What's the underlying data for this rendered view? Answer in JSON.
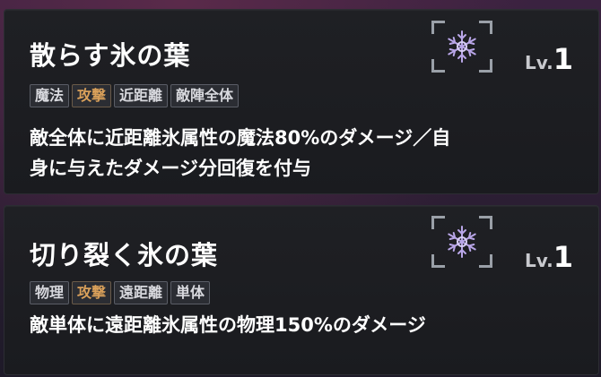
{
  "skills": [
    {
      "name": "散らす氷の葉",
      "level_label": "Lv.",
      "level": "1",
      "tags": [
        "魔法",
        "攻撃",
        "近距離",
        "敵陣全体"
      ],
      "desc_line1": "敵全体に近距離氷属性の魔法80%のダメージ／自",
      "desc_line2": "身に与えたダメージ分回復を付与",
      "icon": "ice-snowflake-icon"
    },
    {
      "name": "切り裂く氷の葉",
      "level_label": "Lv.",
      "level": "1",
      "tags": [
        "物理",
        "攻撃",
        "遠距離",
        "単体"
      ],
      "desc_line1": "敵単体に遠距離氷属性の物理150%のダメージ",
      "icon": "ice-snowflake-icon"
    }
  ],
  "colors": {
    "attack_tag": "#d9a05a",
    "tag_text": "#d8d9de",
    "card_bg": "#1f2024",
    "snowflake": "#b9a6e8"
  }
}
